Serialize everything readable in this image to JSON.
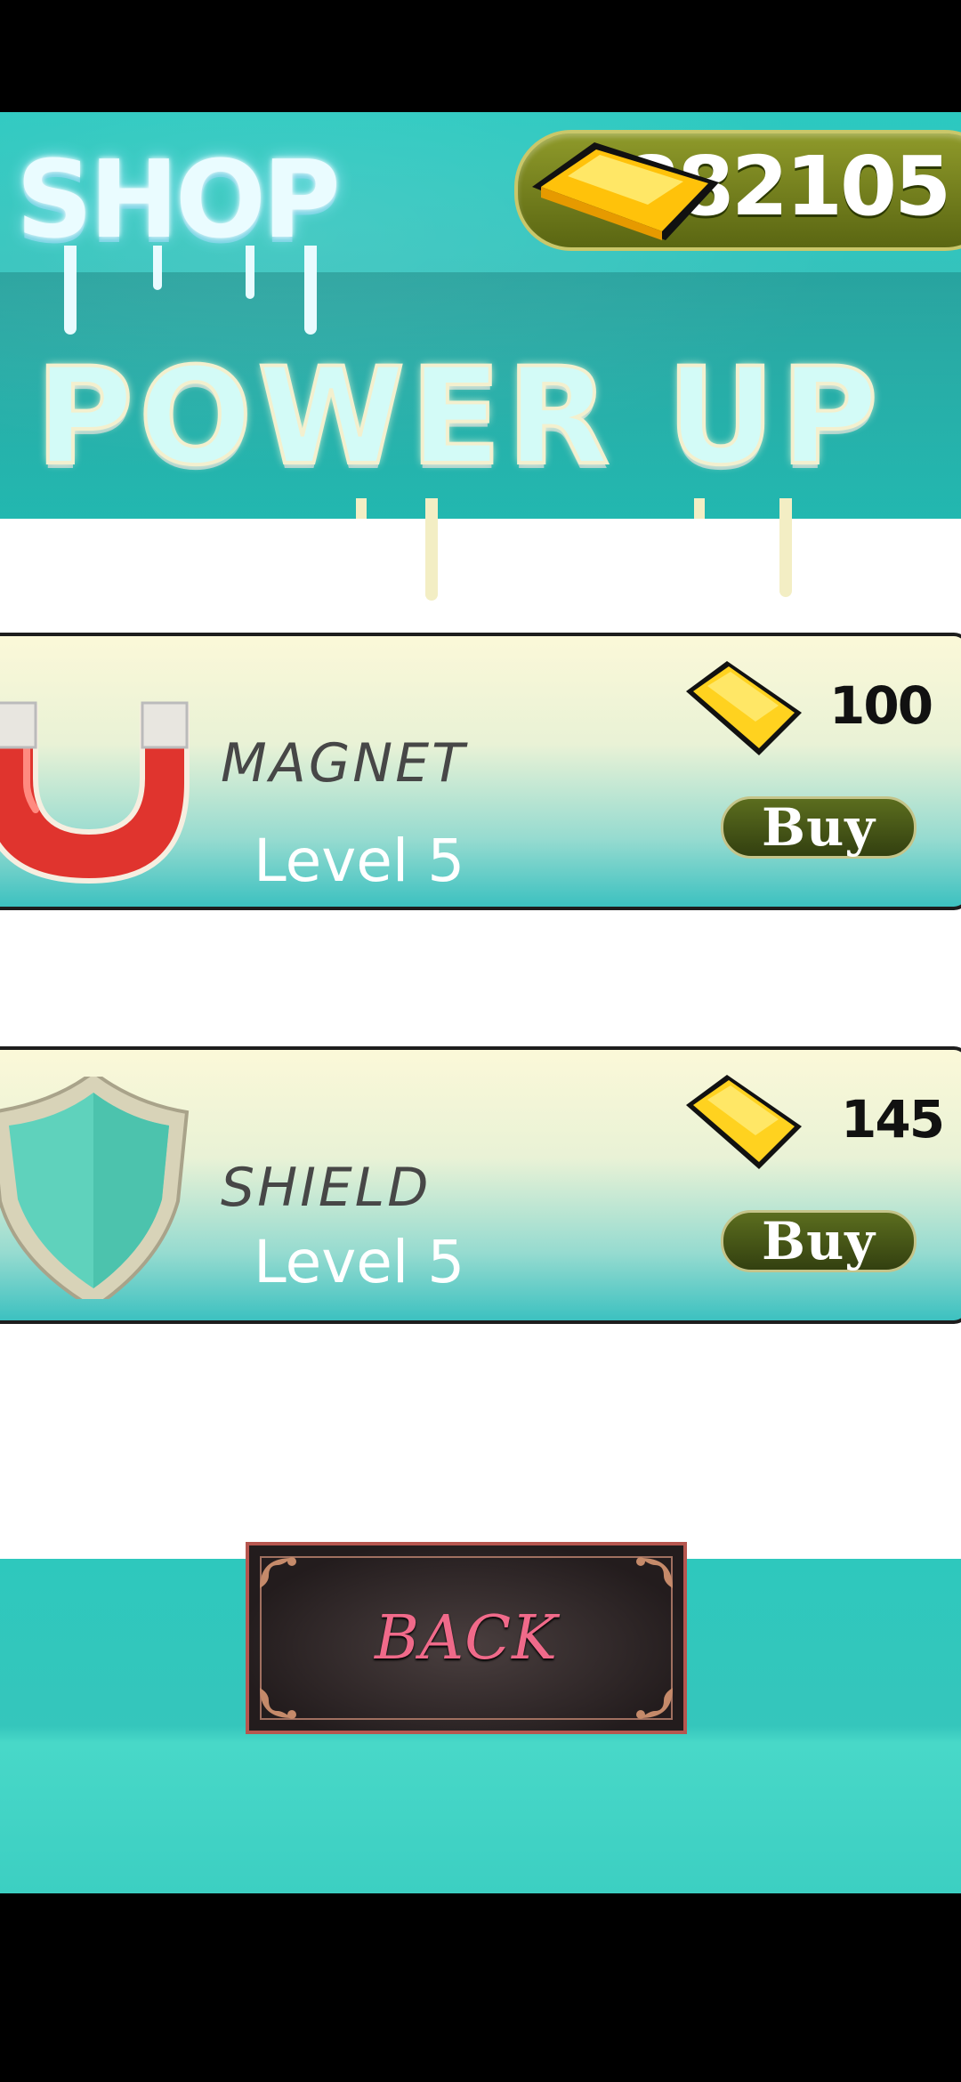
{
  "header": {
    "title": "SHOP",
    "subtitle": "POWER UP",
    "coin_total": "882105",
    "coin_icon": "gold-bar-icon"
  },
  "items": [
    {
      "name": "MAGNET",
      "level": "Level 5",
      "price": "100",
      "buy_label": "Buy",
      "icon": "magnet-icon"
    },
    {
      "name": "SHIELD",
      "level": "Level 5",
      "price": "145",
      "buy_label": "Buy",
      "icon": "shield-icon"
    }
  ],
  "footer": {
    "back_label": "BACK"
  },
  "colors": {
    "teal": "#35c2bc",
    "gold": "#ffd21f",
    "buy_green": "#4a5a16",
    "back_text": "#f06a8a"
  }
}
